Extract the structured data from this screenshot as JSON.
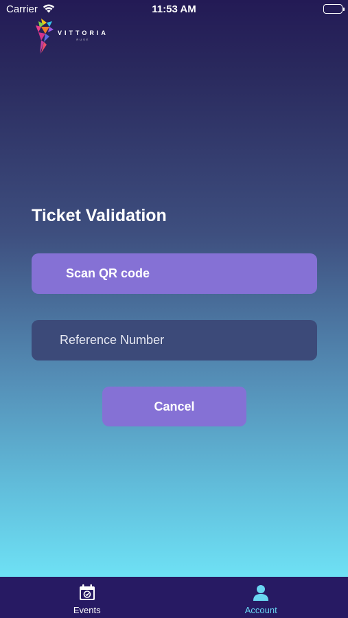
{
  "status_bar": {
    "carrier": "Carrier",
    "time": "11:53 AM"
  },
  "logo": {
    "title": "VITTORIA",
    "subtitle": "RUSE"
  },
  "main": {
    "title": "Ticket Validation",
    "scan_label": "Scan QR code",
    "reference_placeholder": "Reference Number",
    "reference_value": "",
    "cancel_label": "Cancel"
  },
  "tab_bar": {
    "tabs": [
      {
        "label": "Events",
        "icon": "calendar-check-icon",
        "active": false
      },
      {
        "label": "Account",
        "icon": "person-icon",
        "active": true
      }
    ]
  },
  "colors": {
    "button": "#8571d5",
    "input": "#3c4a79",
    "tab_bar": "#271a63",
    "active_tab": "#6ad6f2"
  }
}
